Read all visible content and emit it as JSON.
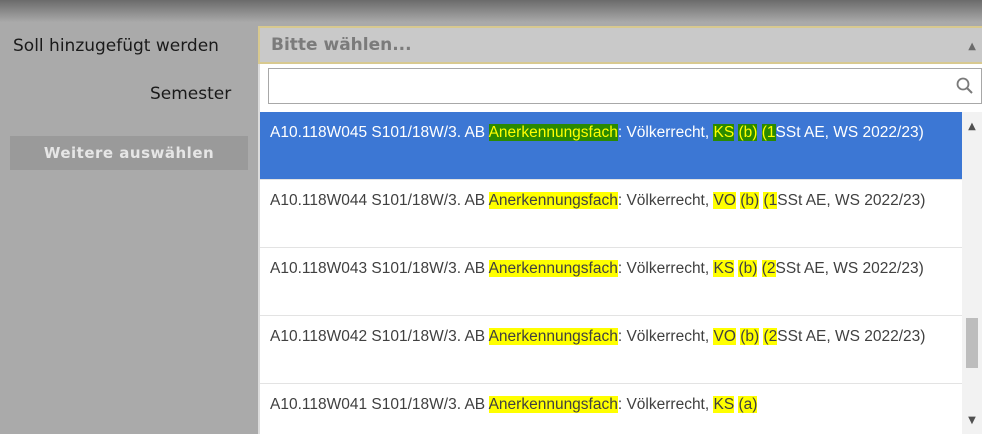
{
  "form": {
    "add_label": "Soll hinzugefügt werden",
    "semester_label": "Semester",
    "more_button": "Weitere auswählen"
  },
  "select": {
    "placeholder": "Bitte wählen...",
    "search_value": "",
    "highlight_terms": [
      "Anerkennungsfach",
      "KS",
      "VO",
      "(b)",
      "(a)",
      "(1",
      "(2"
    ]
  },
  "options": [
    {
      "text_parts": [
        "A10.118W045 S101/18W/3. AB ",
        "Anerkennungsfach",
        ": Völkerrecht, ",
        "KS",
        " ",
        "(b)",
        " ",
        "(1",
        "SSt AE, WS 2022/23)"
      ],
      "selected": true
    },
    {
      "text_parts": [
        "A10.118W044 S101/18W/3. AB ",
        "Anerkennungsfach",
        ": Völkerrecht, ",
        "VO",
        " ",
        "(b)",
        " ",
        "(1",
        "SSt AE, WS 2022/23)"
      ],
      "selected": false
    },
    {
      "text_parts": [
        "A10.118W043 S101/18W/3. AB ",
        "Anerkennungsfach",
        ": Völkerrecht, ",
        "KS",
        " ",
        "(b)",
        " ",
        "(2",
        "SSt AE, WS 2022/23)"
      ],
      "selected": false
    },
    {
      "text_parts": [
        "A10.118W042 S101/18W/3. AB ",
        "Anerkennungsfach",
        ": Völkerrecht, ",
        "VO",
        " ",
        "(b)",
        " ",
        "(2",
        "SSt AE, WS 2022/23)"
      ],
      "selected": false
    },
    {
      "text_parts": [
        "A10.118W041 S101/18W/3. AB ",
        "Anerkennungsfach",
        ": Völkerrecht, ",
        "KS",
        " ",
        "(a)",
        "",
        "",
        ""
      ],
      "selected": false
    }
  ],
  "colors": {
    "selected_bg": "#3c77d4",
    "highlight": "#ffff00",
    "selected_highlight_bg": "#2a8a00"
  },
  "icons": {
    "search": "search-icon",
    "caret": "caret-up-icon",
    "scroll_up": "scroll-up-icon",
    "scroll_down": "scroll-down-icon"
  }
}
